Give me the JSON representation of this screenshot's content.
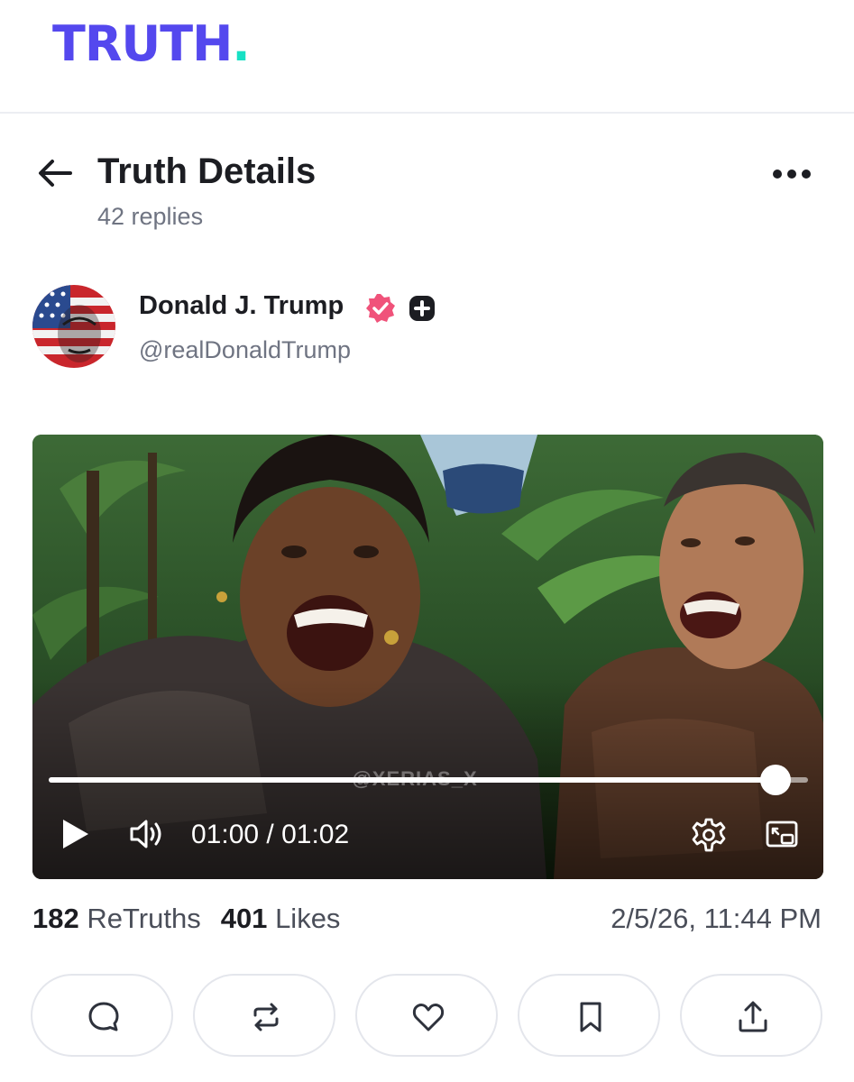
{
  "app": {
    "logo_text": "TRUTH",
    "logo_dot": ".",
    "brand_color": "#5448ee",
    "accent_color": "#17e0c4"
  },
  "header": {
    "title": "Truth Details",
    "subtitle": "42 replies",
    "back_icon": "arrow-left-icon",
    "more_icon": "ellipsis-horizontal-icon"
  },
  "author": {
    "name": "Donald J. Trump",
    "handle": "@realDonaldTrump",
    "verified_icon": "verified-badge-icon",
    "verified_color": "#f0527a",
    "plus_icon": "plus-badge-icon"
  },
  "video": {
    "watermark": "@XERIAS_X",
    "current_time": "01:00",
    "duration": "01:02",
    "time_display": "01:00 / 01:02",
    "progress": 0.957,
    "controls": [
      "play-icon",
      "volume-icon",
      "settings-icon",
      "picture-in-picture-icon"
    ]
  },
  "stats": {
    "retruths_count": "182",
    "retruths_label": "ReTruths",
    "likes_count": "401",
    "likes_label": "Likes",
    "timestamp": "2/5/26, 11:44 PM"
  },
  "actions": [
    {
      "icon": "reply-icon"
    },
    {
      "icon": "retruth-icon"
    },
    {
      "icon": "heart-icon"
    },
    {
      "icon": "bookmark-icon"
    },
    {
      "icon": "share-icon"
    }
  ]
}
